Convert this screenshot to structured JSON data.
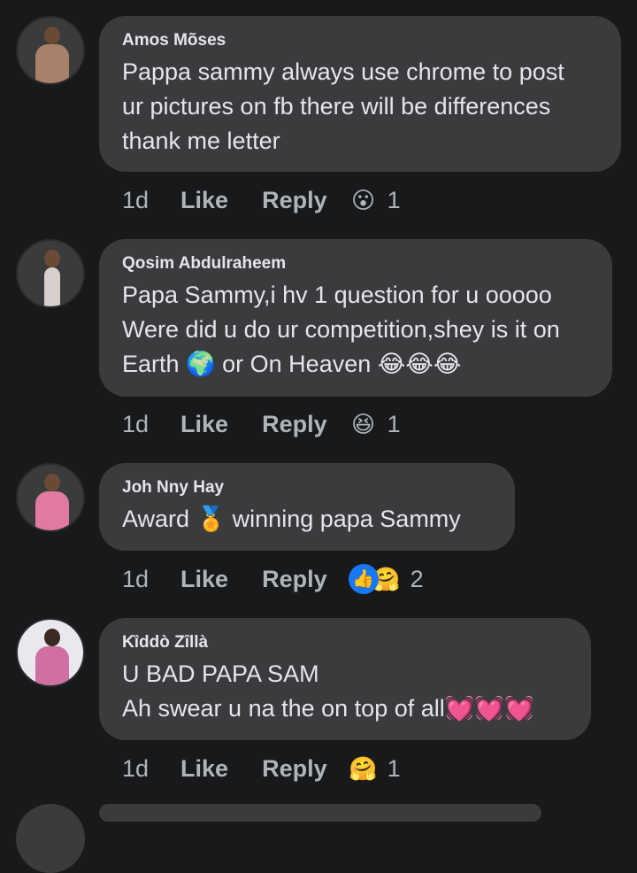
{
  "comments": [
    {
      "author": "Amos Mõses",
      "text": "Pappa sammy always use chrome to post\nur pictures on fb there will be differences\nthank me letter",
      "time": "1d",
      "like_label": "Like",
      "reply_label": "Reply",
      "reaction_icons": [
        "wow-reaction-icon"
      ],
      "reaction_emoji": [
        "😮"
      ],
      "reaction_count": "1",
      "avatar_color": "#a9806a"
    },
    {
      "author": "Qosim Abdulraheem",
      "text": "Papa Sammy,i hv 1 question for u ooooo\nWere did u do ur competition,shey is it on\nEarth 🌍 or On Heaven 😂😂😂",
      "time": "1d",
      "like_label": "Like",
      "reply_label": "Reply",
      "reaction_icons": [
        "haha-reaction-icon"
      ],
      "reaction_emoji": [
        "😆"
      ],
      "reaction_count": "1",
      "avatar_color": "#c9b9b2"
    },
    {
      "author": "Joh Nny Hay",
      "text": "Award 🏅 winning papa Sammy",
      "time": "1d",
      "like_label": "Like",
      "reply_label": "Reply",
      "reaction_icons": [
        "like-reaction-icon",
        "care-reaction-icon"
      ],
      "reaction_emoji": [
        "👍",
        "🤗"
      ],
      "reaction_count": "2",
      "avatar_color": "#e07aa0"
    },
    {
      "author": "Kȉddò Zȋllà",
      "text": "U BAD PAPA SAM\nAh swear u na the on top of all💓💓💓",
      "time": "1d",
      "like_label": "Like",
      "reply_label": "Reply",
      "reaction_icons": [
        "care-reaction-icon"
      ],
      "reaction_emoji": [
        "🤗"
      ],
      "reaction_count": "1",
      "avatar_color": "#d8d8e0"
    }
  ],
  "colors": {
    "background": "#18191a",
    "bubble": "#3a3b3c",
    "text": "#e4e6eb",
    "secondary": "#b0b3b8",
    "like_blue": "#1877f2"
  }
}
